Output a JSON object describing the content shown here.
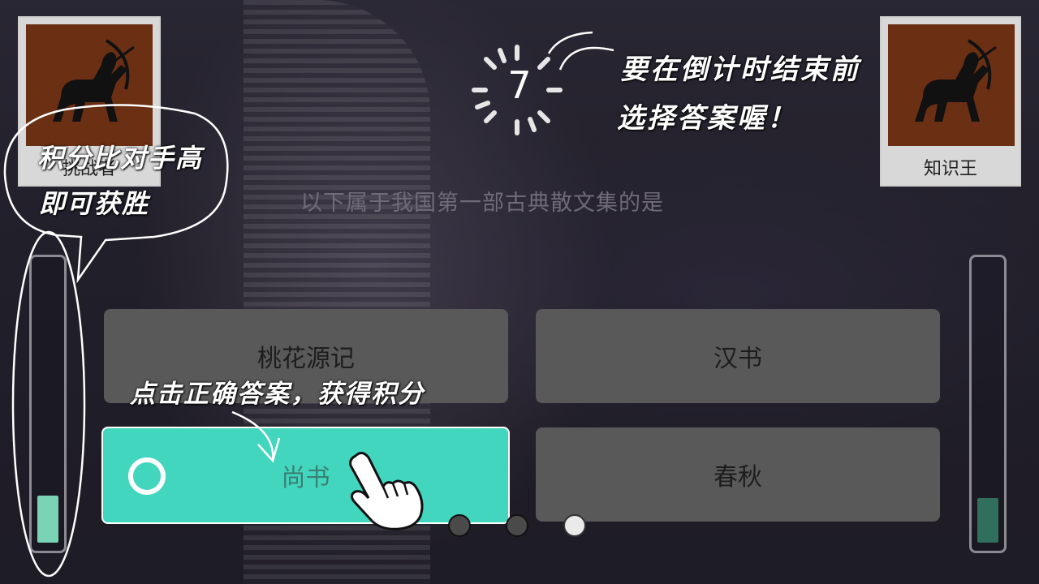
{
  "timer": {
    "seconds": "7"
  },
  "players": {
    "left": {
      "name": "挑战者",
      "icon": "sagittarius-icon"
    },
    "right": {
      "name": "知识王",
      "icon": "sagittarius-icon"
    }
  },
  "question": "以下属于我国第一部古典散文集的是",
  "options": [
    {
      "label": "桃花源记"
    },
    {
      "label": "汉书"
    },
    {
      "label": "尚书",
      "selected": true
    },
    {
      "label": "春秋"
    }
  ],
  "score_bars": {
    "left_fraction": 0.17,
    "right_fraction": 0.16
  },
  "progress_dots": {
    "total": 3,
    "current": 3
  },
  "hints": {
    "timer_hint_line1": "要在倒计时结束前",
    "timer_hint_line2": "选择答案喔！",
    "score_hint_line1": "积分比对手高",
    "score_hint_line2": "即可获胜",
    "answer_hint": "点击正确答案，获得积分"
  },
  "colors": {
    "selected_option": "#42d6be",
    "option_bg": "#595959",
    "left_bar": "#79d3b4",
    "right_bar": "#2f6f5c"
  }
}
